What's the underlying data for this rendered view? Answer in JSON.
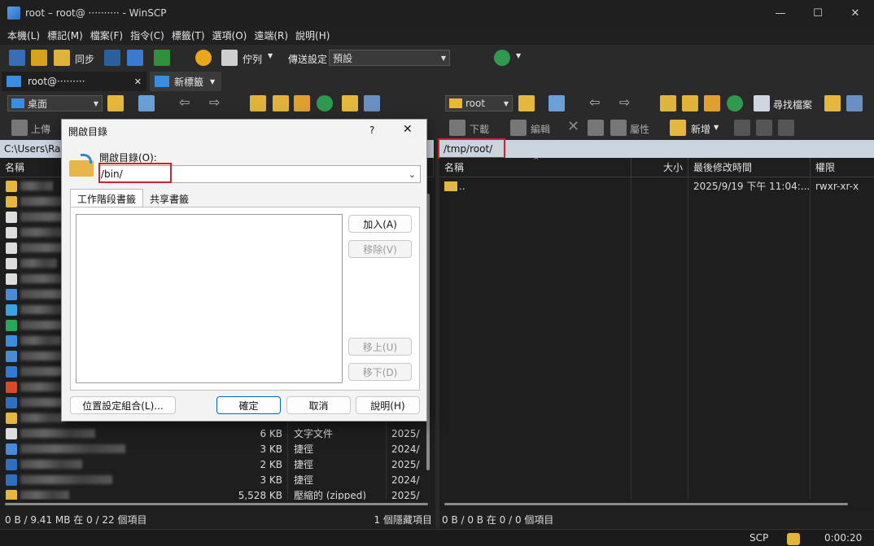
{
  "window": {
    "title": "root – root@ ·········· - WinSCP"
  },
  "menu": [
    "本機(L)",
    "標記(M)",
    "檔案(F)",
    "指令(C)",
    "標籤(T)",
    "選項(O)",
    "遠端(R)",
    "說明(H)"
  ],
  "toolbar": {
    "sync_label": "同步",
    "queue_label": "佇列",
    "transfer_label": "傳送設定",
    "transfer_value": "預設"
  },
  "tabs": [
    {
      "label": "root@·········"
    },
    {
      "label": "新標籤"
    }
  ],
  "left": {
    "location": "桌面",
    "upload_label": "上傳",
    "path": "C:\\Users\\Ray",
    "col_name": "名稱",
    "rows": [
      {
        "size": "6 KB",
        "type": "文字文件",
        "date": "2025/"
      },
      {
        "size": "3 KB",
        "type": "捷徑",
        "date": "2024/"
      },
      {
        "size": "2 KB",
        "type": "捷徑",
        "date": "2025/"
      },
      {
        "size": "3 KB",
        "type": "捷徑",
        "date": "2024/"
      },
      {
        "size": "5,528 KB",
        "type": "壓縮的 (zipped)",
        "date": "2025/"
      }
    ],
    "status_left": "0 B / 9.41 MB 在 0 / 22 個項目",
    "status_right": "1 個隱藏項目"
  },
  "right": {
    "location": "root",
    "find_label": "尋找檔案",
    "download_label": "下載",
    "edit_label": "編輯",
    "props_label": "屬性",
    "new_label": "新增",
    "path": "/tmp/root/",
    "cols": {
      "name": "名稱",
      "size": "大小",
      "modified": "最後修改時間",
      "perms": "權限"
    },
    "rows": [
      {
        "name": "..",
        "modified": "2025/9/19 下午 11:04:...",
        "perms": "rwxr-xr-x"
      }
    ],
    "status": "0 B / 0 B 在 0 / 0 個項目"
  },
  "statusbar": {
    "protocol": "SCP",
    "timer": "0:00:20"
  },
  "dialog": {
    "title": "開啟目錄",
    "help_glyph": "?",
    "label": "開啟目錄(O):",
    "value": "/bin/",
    "tab_session": "工作階段書籤",
    "tab_shared": "共享書籤",
    "add": "加入(A)",
    "remove": "移除(V)",
    "up": "移上(U)",
    "down": "移下(D)",
    "location_profiles": "位置設定組合(L)...",
    "ok": "確定",
    "cancel": "取消",
    "help": "說明(H)"
  }
}
